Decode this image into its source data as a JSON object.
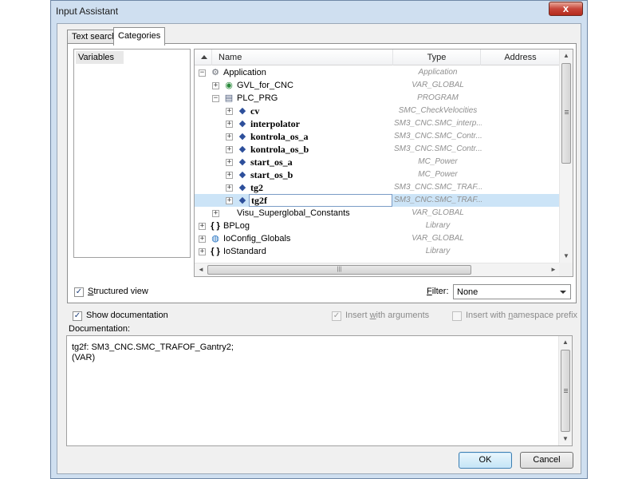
{
  "window": {
    "title": "Input Assistant",
    "close_glyph": "x"
  },
  "tabs": [
    {
      "label": "Text search",
      "active": false
    },
    {
      "label": "Categories",
      "active": true
    }
  ],
  "categories": [
    {
      "label": "Variables",
      "selected": true
    }
  ],
  "tree": {
    "columns": {
      "name": "Name",
      "type": "Type",
      "address": "Address"
    },
    "rows": [
      {
        "name": "Application",
        "type": "Application",
        "icon": "application-gear-icon",
        "expander": "−",
        "selected": false
      },
      {
        "name": "GVL_for_CNC",
        "type": "VAR_GLOBAL",
        "icon": "gvl-globe-icon",
        "expander": "+",
        "selected": false
      },
      {
        "name": "PLC_PRG",
        "type": "PROGRAM",
        "icon": "program-page-icon",
        "expander": "−",
        "selected": false
      },
      {
        "name": "cv",
        "type": "SMC_CheckVelocities",
        "icon": "variable-diamond-icon",
        "expander": "+",
        "selected": false
      },
      {
        "name": "interpolator",
        "type": "SM3_CNC.SMC_interp...",
        "icon": "variable-diamond-icon",
        "expander": "+",
        "selected": false
      },
      {
        "name": "kontrola_os_a",
        "type": "SM3_CNC.SMC_Contr...",
        "icon": "variable-diamond-icon",
        "expander": "+",
        "selected": false
      },
      {
        "name": "kontrola_os_b",
        "type": "SM3_CNC.SMC_Contr...",
        "icon": "variable-diamond-icon",
        "expander": "+",
        "selected": false
      },
      {
        "name": "start_os_a",
        "type": "MC_Power",
        "icon": "variable-diamond-icon",
        "expander": "+",
        "selected": false
      },
      {
        "name": "start_os_b",
        "type": "MC_Power",
        "icon": "variable-diamond-icon",
        "expander": "+",
        "selected": false
      },
      {
        "name": "tg2",
        "type": "SM3_CNC.SMC_TRAF...",
        "icon": "variable-diamond-icon",
        "expander": "+",
        "selected": false
      },
      {
        "name": "tg2f",
        "type": "SM3_CNC.SMC_TRAF...",
        "icon": "variable-diamond-icon",
        "expander": "+",
        "selected": true
      },
      {
        "name": "Visu_Superglobal_Constants",
        "type": "VAR_GLOBAL",
        "icon": "",
        "expander": "+",
        "selected": false
      },
      {
        "name": "BPLog",
        "type": "Library",
        "icon": "library-braces-icon",
        "expander": "+",
        "selected": false
      },
      {
        "name": "IoConfig_Globals",
        "type": "VAR_GLOBAL",
        "icon": "globe-icon",
        "expander": "+",
        "selected": false
      },
      {
        "name": "IoStandard",
        "type": "Library",
        "icon": "library-braces-icon",
        "expander": "+",
        "selected": false
      }
    ]
  },
  "structured_view": {
    "label_pre": "",
    "label_u": "S",
    "label_post": "tructured view",
    "checked": true
  },
  "filter": {
    "label_u": "F",
    "label_post": "ilter:",
    "value": "None"
  },
  "show_documentation": {
    "label": "Show documentation",
    "checked": true
  },
  "insert_with_arguments": {
    "label_pre": "Insert ",
    "label_u": "w",
    "label_post": "ith arguments",
    "checked": true,
    "enabled": false
  },
  "insert_with_namespace": {
    "label_pre": "Insert with ",
    "label_u": "n",
    "label_post": "amespace prefix",
    "checked": false,
    "enabled": false
  },
  "documentation": {
    "label": "Documentation:",
    "text": "tg2f: SM3_CNC.SMC_TRAFOF_Gantry2;\n(VAR)"
  },
  "buttons": {
    "ok": "OK",
    "cancel": "Cancel"
  },
  "glyphs": {
    "check": "✓",
    "up": "▲",
    "down": "▼",
    "left": "◄",
    "right": "►",
    "grip": "|||",
    "braces": "{ }"
  }
}
